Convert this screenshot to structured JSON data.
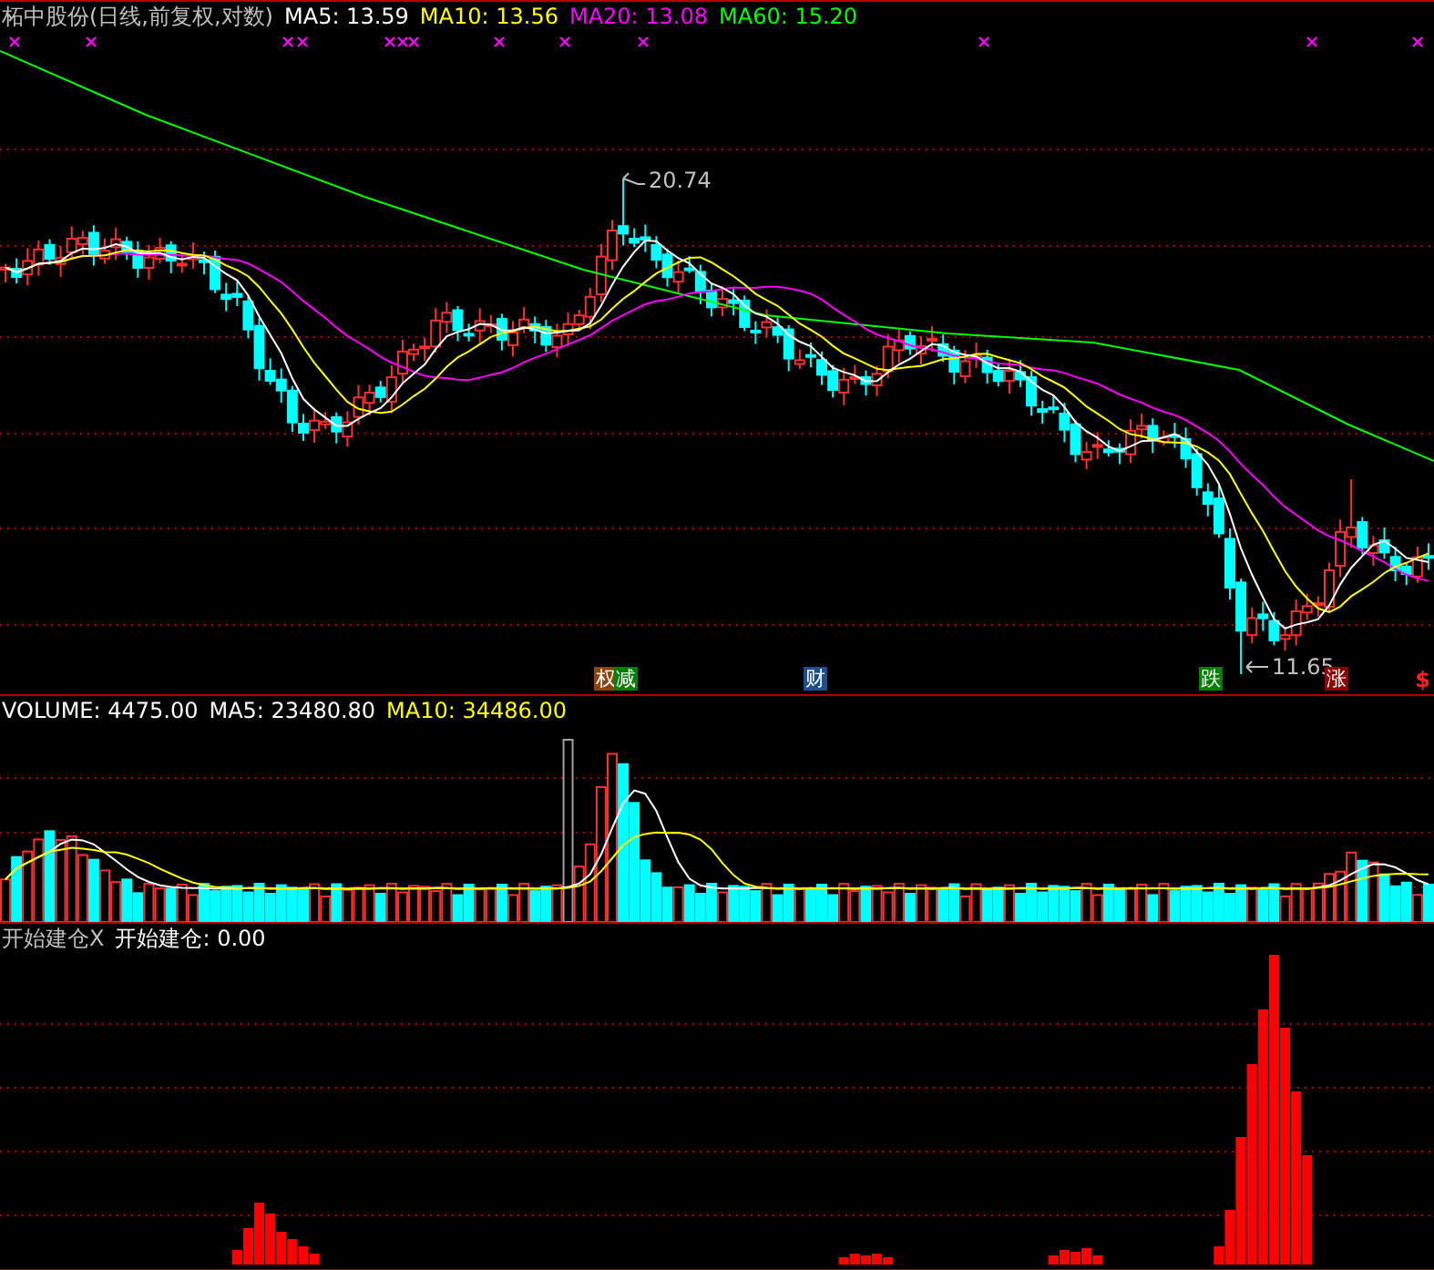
{
  "main_panel": {
    "title": "柘中股份(日线,前复权,对数)",
    "indicators": [
      {
        "label": "MA5: 13.59",
        "color": "#ffffff"
      },
      {
        "label": "MA10: 13.56",
        "color": "#ffff00"
      },
      {
        "label": "MA20: 13.08",
        "color": "#ff00ff"
      },
      {
        "label": "MA60: 15.20",
        "color": "#00ff00"
      }
    ],
    "high_label": "20.74",
    "low_label": "11.65",
    "badges": [
      {
        "text": "权",
        "color": "#8b4513"
      },
      {
        "text": "减",
        "color": "#008000"
      },
      {
        "text": "财",
        "color": "#1e4f8c"
      },
      {
        "text": "跌",
        "color": "#008000"
      },
      {
        "text": "涨",
        "color": "#8b0000"
      }
    ],
    "end_mark": "$"
  },
  "volume_panel": {
    "indicators": [
      {
        "label": "VOLUME: 4475.00",
        "color": "#ffffff"
      },
      {
        "label": "MA5: 23480.80",
        "color": "#ffffff"
      },
      {
        "label": "MA10: 34486.00",
        "color": "#ffff00"
      }
    ]
  },
  "signal_panel": {
    "indicators": [
      {
        "label": "开始建仓X",
        "color": "#c0c0c0"
      },
      {
        "label": "开始建仓: 0.00",
        "color": "#ffffff"
      }
    ]
  }
}
